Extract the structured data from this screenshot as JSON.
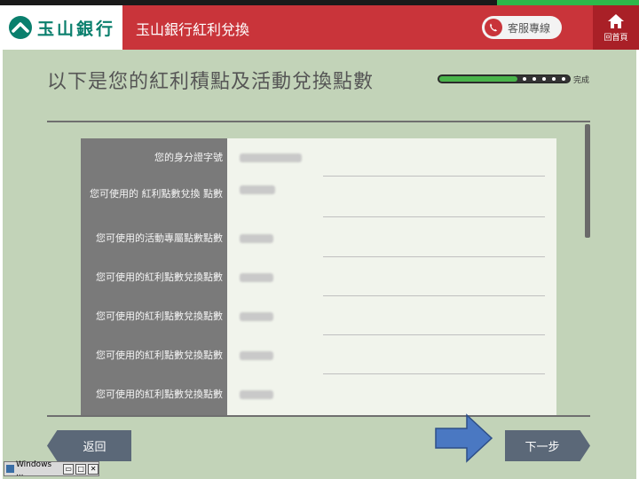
{
  "header": {
    "logo_text": "玉山銀行",
    "title": "玉山銀行紅利兌換",
    "service_label": "客服專線",
    "home_label": "回首頁",
    "brand_color": "#c9343a",
    "logo_color": "#0a7f6d"
  },
  "page": {
    "title": "以下是您的紅利積點及活動兌換點數",
    "progress_label": "完成",
    "progress_fraction": 0.6
  },
  "form": {
    "rows": [
      {
        "label": "您的身分證字號"
      },
      {
        "label": "您可使用的 紅利點數兌換 點數"
      },
      {
        "label": "您可使用的活動專屬點數點數"
      },
      {
        "label": "您可使用的紅利點數兌換點數"
      },
      {
        "label": "您可使用的紅利點數兌換點數"
      },
      {
        "label": "您可使用的紅利點數兌換點數"
      },
      {
        "label": "您可使用的紅利點數兌換點數"
      }
    ]
  },
  "nav": {
    "back_label": "返回",
    "next_label": "下一步"
  },
  "taskbar": {
    "label": "Windows ..."
  }
}
